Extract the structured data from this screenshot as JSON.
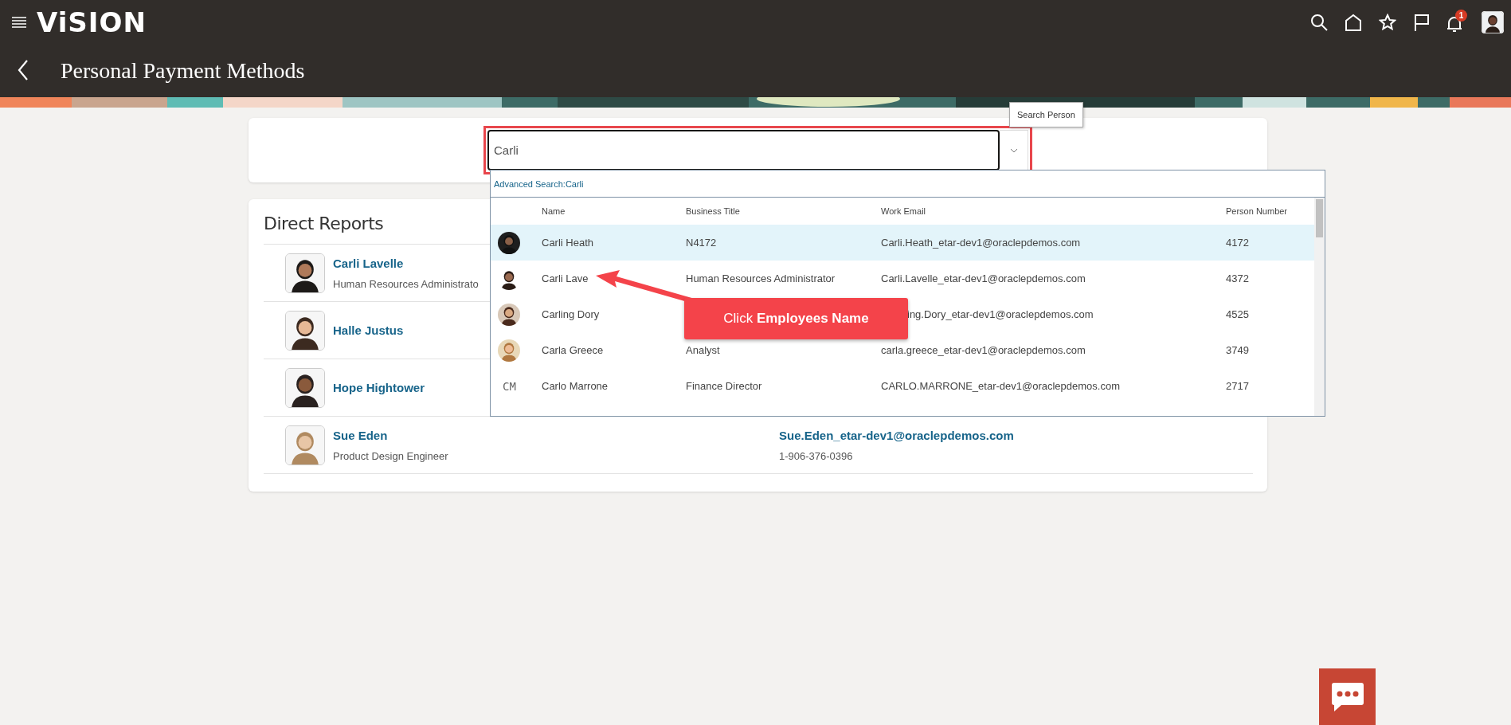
{
  "app": {
    "logo": "ViSION",
    "notification_count": "1"
  },
  "page_title": "Personal Payment Methods",
  "search": {
    "value": "Carli",
    "tooltip": "Search Person"
  },
  "dropdown": {
    "advanced_search": "Advanced Search:Carli",
    "columns": [
      "Name",
      "Business Title",
      "Work Email",
      "Person Number"
    ],
    "rows": [
      {
        "name": "Carli Heath",
        "title": "N4172",
        "email": "Carli.Heath_etar-dev1@oraclepdemos.com",
        "number": "4172",
        "selected": true,
        "covered": false
      },
      {
        "name": "Carli Lave",
        "title": "Human Resources Administrator",
        "email": "Carli.Lavelle_etar-dev1@oraclepdemos.com",
        "number": "4372",
        "selected": false,
        "covered": false
      },
      {
        "name": "Carling Dory",
        "email": "ing.Dory_etar-dev1@oraclepdemos.com",
        "number": "4525",
        "selected": false,
        "covered": true
      },
      {
        "name": "Carla Greece",
        "title": "Analyst",
        "email": "carla.greece_etar-dev1@oraclepdemos.com",
        "number": "3749",
        "selected": false,
        "covered": false
      },
      {
        "kind": "initials",
        "initials": "CM",
        "name": "Carlo Marrone",
        "title": "Finance Director",
        "email": "CARLO.MARRONE_etar-dev1@oraclepdemos.com",
        "number": "2717",
        "selected": false,
        "covered": false
      }
    ]
  },
  "direct_reports": {
    "title": "Direct Reports",
    "people": [
      {
        "name": "Carli Lavelle",
        "title": "Human Resources Administrato"
      },
      {
        "name": "Halle Justus"
      },
      {
        "name": "Hope Hightower"
      },
      {
        "name": "Sue Eden",
        "title": "Product Design Engineer",
        "email": "Sue.Eden_etar-dev1@oraclepdemos.com",
        "phone": "1-906-376-0396"
      }
    ]
  },
  "callout": {
    "text": "Click **Employees Name**"
  }
}
